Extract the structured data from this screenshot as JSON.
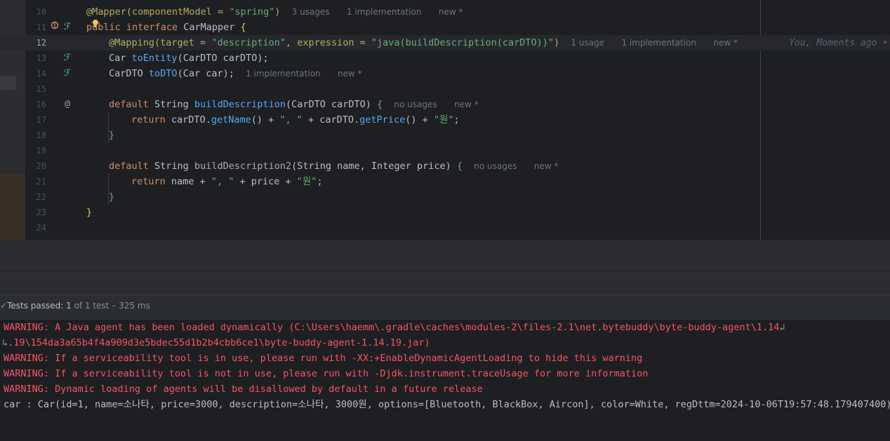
{
  "editor": {
    "lines": [
      {
        "num": "10"
      },
      {
        "num": "11"
      },
      {
        "num": "12"
      },
      {
        "num": "13"
      },
      {
        "num": "14"
      },
      {
        "num": "15"
      },
      {
        "num": "16"
      },
      {
        "num": "17"
      },
      {
        "num": "18"
      },
      {
        "num": "19"
      },
      {
        "num": "20"
      },
      {
        "num": "21"
      },
      {
        "num": "22"
      },
      {
        "num": "23"
      },
      {
        "num": "24"
      }
    ],
    "l10": {
      "ann": "@Mapper",
      "p1": "(componentModel = ",
      "str": "\"spring\"",
      "p2": ")",
      "hint_usages": "3 usages",
      "hint_impl": "1 implementation",
      "hint_new": "new *"
    },
    "l11": {
      "kw1": "public",
      "kw2": "interface",
      "cls": "CarMapper",
      "brace": "{"
    },
    "l12": {
      "ann": "@Mapping",
      "p1": "(target = ",
      "s1": "\"description\"",
      "p2": ", expression = ",
      "s2": "\"java(buildDescription(carDTO))\"",
      "p3": ")",
      "hint_usages": "1 usage",
      "hint_impl": "1 implementation",
      "hint_new": "new *",
      "blame": "You, Moments ago • Uncommitted changes"
    },
    "l13": {
      "type": "Car",
      "fn": "toEntity",
      "args": "(CarDTO carDTO);"
    },
    "l14": {
      "type": "CarDTO",
      "fn": "toDTO",
      "args": "(Car car);",
      "hint_impl": "1 implementation",
      "hint_new": "new *"
    },
    "l16": {
      "kw": "default",
      "type": "String",
      "fn": "buildDescription",
      "args": "(CarDTO carDTO)",
      "brace": "{",
      "hint_usages": "no usages",
      "hint_new": "new *"
    },
    "l17": {
      "kw": "return",
      "t1": "carDTO.",
      "f1": "getName",
      "t2": "() + ",
      "s1": "\", \"",
      "t3": " + carDTO.",
      "f2": "getPrice",
      "t4": "() + ",
      "s2": "\"원\"",
      "t5": ";"
    },
    "l18": {
      "brace": "}"
    },
    "l20": {
      "kw": "default",
      "type": "String",
      "fn": "buildDescription2",
      "args": "(String name, Integer price)",
      "brace": "{",
      "hint_usages": "no usages",
      "hint_new": "new *"
    },
    "l21": {
      "kw": "return",
      "t1": "name + ",
      "s1": "\", \"",
      "t2": " + price + ",
      "s2": "\"원\"",
      "t3": ";"
    },
    "l22": {
      "brace": "}"
    },
    "l23": {
      "brace": "}"
    }
  },
  "test_status": {
    "label": "Tests passed:",
    "count": "1",
    "of": "of 1 test",
    "duration": "– 325 ms"
  },
  "console": {
    "lines": [
      "WARNING: A Java agent has been loaded dynamically (C:\\Users\\haemm\\.gradle\\caches\\modules-2\\files-2.1\\net.bytebuddy\\byte-buddy-agent\\1.14",
      ".19\\154da3a65b4f4a909d3e5bdec55d1b2b4cbb6ce1\\byte-buddy-agent-1.14.19.jar)",
      "WARNING: If a serviceability tool is in use, please run with -XX:+EnableDynamicAgentLoading to hide this warning",
      "WARNING: If a serviceability tool is not in use, please run with -Djdk.instrument.traceUsage for more information",
      "WARNING: Dynamic loading of agents will be disallowed by default in a future release",
      "car : Car(id=1, name=소나타, price=3000, description=소나타, 3000원, options=[Bluetooth, BlackBox, Aircon], color=White, regDttm=2024-10-06T19:57:48.179407400)"
    ]
  },
  "colors": {
    "error": "#f75464",
    "keyword": "#cf8e6d",
    "string": "#6aab73",
    "annotation": "#b3ae60",
    "function": "#56a8f5"
  },
  "icons": {
    "bulb": "lightbulb-icon",
    "impl": "implemented-method-icon",
    "override": "override-icon",
    "debug": "debug-icon",
    "check": "check-icon",
    "wrap": "soft-wrap-icon"
  }
}
